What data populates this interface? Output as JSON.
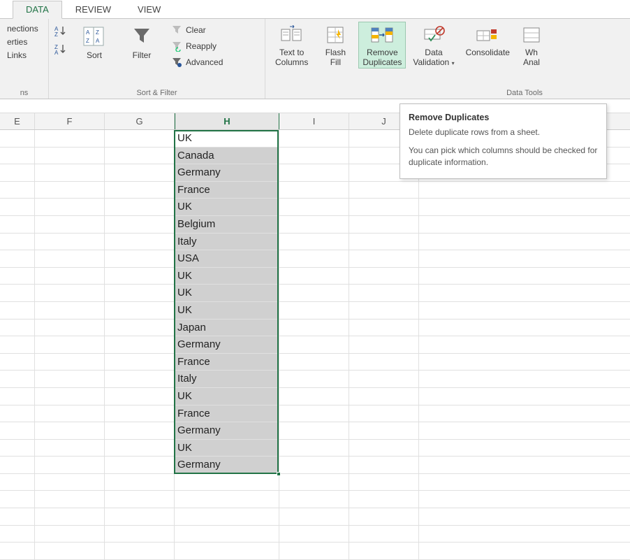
{
  "tabs": {
    "data": "DATA",
    "review": "REVIEW",
    "view": "VIEW"
  },
  "conn_group": {
    "l1": "nections",
    "l2": "erties",
    "l3": "Links",
    "label": "ns"
  },
  "sort_group": {
    "sort": "Sort",
    "filter": "Filter",
    "clear": "Clear",
    "reapply": "Reapply",
    "advanced": "Advanced",
    "label": "Sort & Filter"
  },
  "tools_group": {
    "text_to_columns": "Text to\nColumns",
    "flash_fill": "Flash\nFill",
    "remove_duplicates": "Remove\nDuplicates",
    "data_validation": "Data\nValidation",
    "consolidate": "Consolidate",
    "what_if": "Wh\nAnal",
    "label": "Data Tools"
  },
  "tooltip": {
    "title": "Remove Duplicates",
    "p1": "Delete duplicate rows from a sheet.",
    "p2": "You can pick which columns should be checked for duplicate information."
  },
  "columns": {
    "e": "E",
    "f": "F",
    "g": "G",
    "h": "H",
    "i": "I",
    "j": "J"
  },
  "col_widths": {
    "stub": 0,
    "e": 50,
    "f": 100,
    "g": 100,
    "h": 150,
    "i": 100,
    "j": 100,
    "rest": 302
  },
  "data_rows": [
    "UK",
    "Canada",
    "Germany",
    "France",
    "UK",
    "Belgium",
    "Italy",
    "USA",
    "UK",
    "UK",
    "UK",
    "Japan",
    "Germany",
    "France",
    "Italy",
    "UK",
    "France",
    "Germany",
    "UK",
    "Germany"
  ],
  "extra_empty_rows": 5
}
